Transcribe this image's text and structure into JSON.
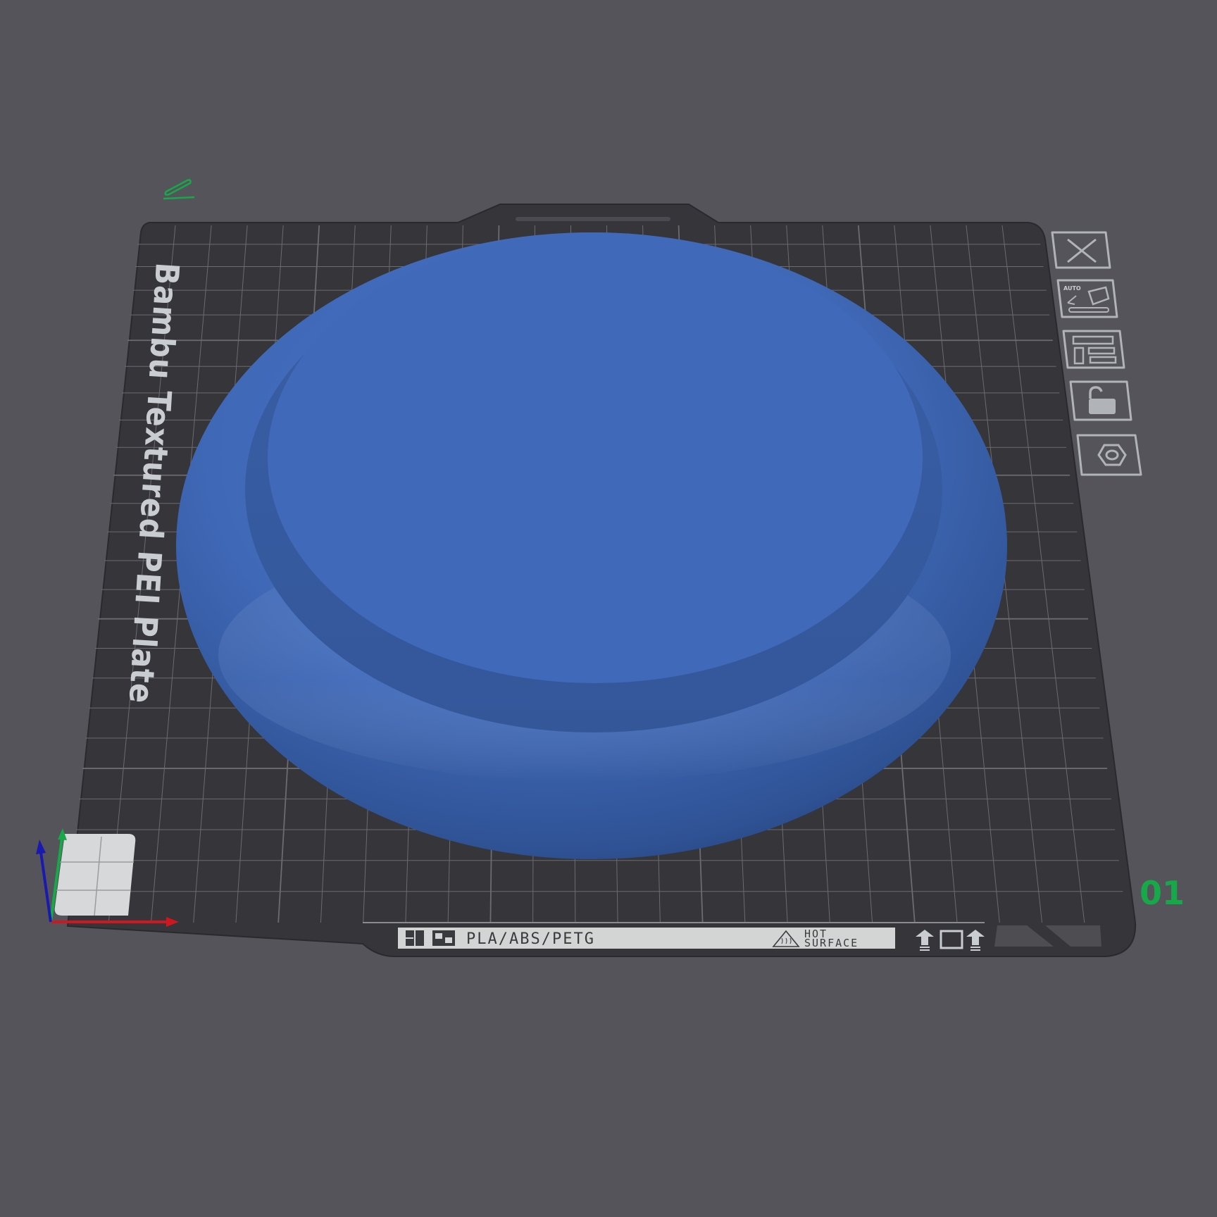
{
  "scene": {
    "background_color": "#55545a",
    "plate_color": "#35353a",
    "grid_color": "#6b6b70",
    "model_color": "#4069b9"
  },
  "plate": {
    "name": "Bambu Textured PEI Plate",
    "material_text": "PLA/ABS/PETG",
    "hot_surface_line1": "HOT",
    "hot_surface_line2": "SURFACE",
    "plate_number": "01",
    "edit_icon": "pencil-icon"
  },
  "plate_toolbar": [
    {
      "name": "delete-plate-button",
      "icon": "close-icon"
    },
    {
      "name": "auto-arrange-button",
      "icon": "auto-orient-icon",
      "label": "AUTO"
    },
    {
      "name": "arrange-button",
      "icon": "arrange-icon"
    },
    {
      "name": "lock-plate-button",
      "icon": "unlock-icon"
    },
    {
      "name": "plate-settings-button",
      "icon": "hexagon-settings-icon"
    }
  ],
  "axes": {
    "x_color": "#d0171f",
    "y_color": "#17a84a",
    "z_color": "#1a1ab0"
  }
}
